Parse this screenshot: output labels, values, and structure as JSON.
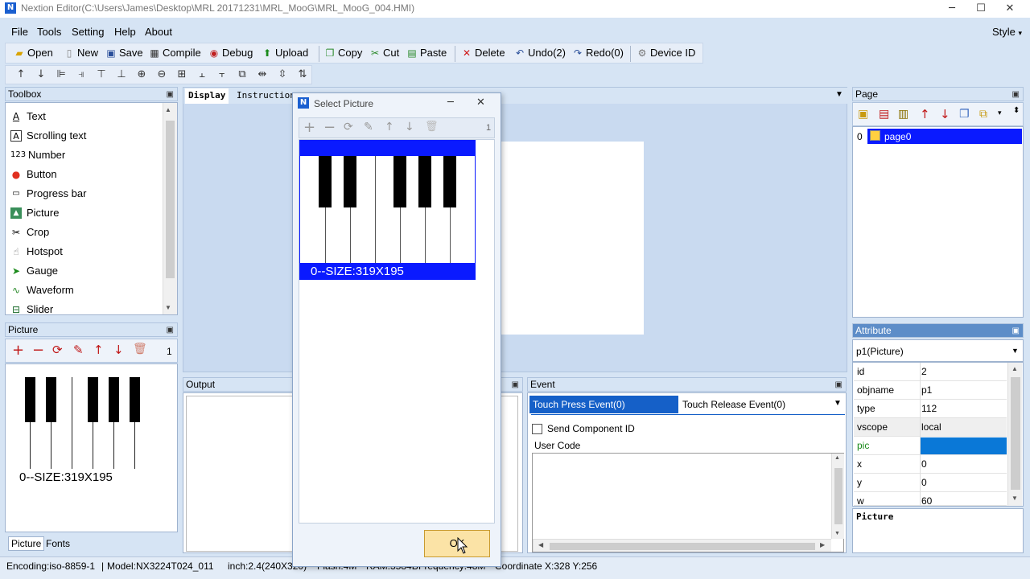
{
  "window": {
    "title": "Nextion Editor(C:\\Users\\James\\Desktop\\MRL 20171231\\MRL_MooG\\MRL_MooG_004.HMI)",
    "minimize": "─",
    "maximize": "☐",
    "close": "✕"
  },
  "menu": [
    "File",
    "Tools",
    "Setting",
    "Help",
    "About"
  ],
  "style_menu": "Style",
  "toolbar": {
    "open": "Open",
    "new": "New",
    "save": "Save",
    "compile": "Compile",
    "debug": "Debug",
    "upload": "Upload",
    "copy": "Copy",
    "cut": "Cut",
    "paste": "Paste",
    "delete": "Delete",
    "undo": "Undo(2)",
    "redo": "Redo(0)",
    "device_id": "Device  ID"
  },
  "toolbox": {
    "title": "Toolbox",
    "items": [
      "Text",
      "Scrolling text",
      "Number",
      "Button",
      "Progress bar",
      "Picture",
      "Crop",
      "Hotspot",
      "Gauge",
      "Waveform",
      "Slider"
    ]
  },
  "picture_panel": {
    "title": "Picture",
    "count": "1",
    "caption": "0--SIZE:319X195",
    "tabs": [
      "Picture",
      "Fonts"
    ]
  },
  "center": {
    "tabs": [
      "Display",
      "Instructions"
    ],
    "output_title": "Output"
  },
  "dialog": {
    "title": "Select Picture",
    "count": "1",
    "caption": "0--SIZE:319X195",
    "ok": "OK"
  },
  "event": {
    "title": "Event",
    "tab_press": "Touch Press Event(0)",
    "tab_release": "Touch Release Event(0)",
    "send_component_id": "Send Component ID",
    "user_code": "User Code"
  },
  "page_panel": {
    "title": "Page",
    "index": "0",
    "page_name": "page0"
  },
  "attribute": {
    "title": "Attribute",
    "selected": "p1(Picture)",
    "rows": [
      {
        "k": "id",
        "v": "2"
      },
      {
        "k": "objname",
        "v": "p1"
      },
      {
        "k": "type",
        "v": "112"
      },
      {
        "k": "vscope",
        "v": "local"
      },
      {
        "k": "pic",
        "v": ""
      },
      {
        "k": "x",
        "v": "0"
      },
      {
        "k": "y",
        "v": "0"
      },
      {
        "k": "w",
        "v": "60"
      }
    ],
    "description": "Picture"
  },
  "status": {
    "encoding": "Encoding:iso-8859-1",
    "model": "Model:NX3224T024_011",
    "inch": "inch:2.4(240X320)",
    "flash": "Flash:4M",
    "ram": "RAM:3584B",
    "frequency": "Frequency:48M",
    "coordinate": "Coordinate X:328  Y:256"
  },
  "colors": {
    "accent": "#0a1aff",
    "selection": "#0064e6",
    "pic_highlight": "#0a78d7",
    "ok_button": "#fbe3a6"
  }
}
